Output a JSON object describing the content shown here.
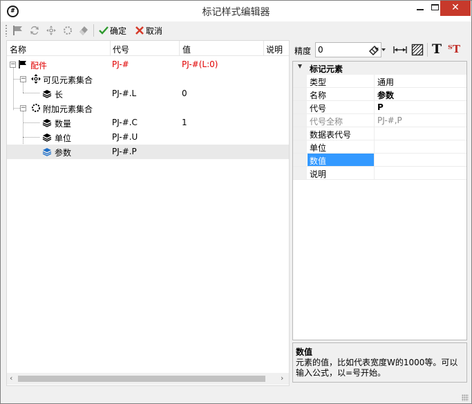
{
  "window": {
    "title": "标记样式编辑器"
  },
  "toolbar": {
    "ok_label": "确定",
    "cancel_label": "取消"
  },
  "tree": {
    "columns": [
      "名称",
      "代号",
      "值",
      "说明"
    ],
    "rows": [
      {
        "name": "配件",
        "code": "PJ-#",
        "value": "PJ-#(L:0)"
      },
      {
        "name": "可见元素集合",
        "code": "",
        "value": ""
      },
      {
        "name": "长",
        "code": "PJ-#.L",
        "value": "0"
      },
      {
        "name": "附加元素集合",
        "code": "",
        "value": ""
      },
      {
        "name": "数量",
        "code": "PJ-#.C",
        "value": "1"
      },
      {
        "name": "单位",
        "code": "PJ-#.U",
        "value": ""
      },
      {
        "name": "参数",
        "code": "PJ-#.P",
        "value": ""
      }
    ]
  },
  "format_toolbar": {
    "precision_label": "精度",
    "precision_value": "0"
  },
  "props": {
    "category": "标记元素",
    "rows": [
      {
        "name": "类型",
        "value": "通用"
      },
      {
        "name": "名称",
        "value": "参数"
      },
      {
        "name": "代号",
        "value": "P"
      },
      {
        "name": "代号全称",
        "value": "PJ-#,P"
      },
      {
        "name": "数据表代号",
        "value": ""
      },
      {
        "name": "单位",
        "value": ""
      },
      {
        "name": "数值",
        "value": ""
      },
      {
        "name": "说明",
        "value": ""
      }
    ]
  },
  "description": {
    "title": "数值",
    "text": "元素的值，比如代表宽度W的1000等。可以输入公式，以=号开始。"
  },
  "colors": {
    "accent": "#3399ff",
    "highlight": "#e00000",
    "close": "#c7392b"
  }
}
